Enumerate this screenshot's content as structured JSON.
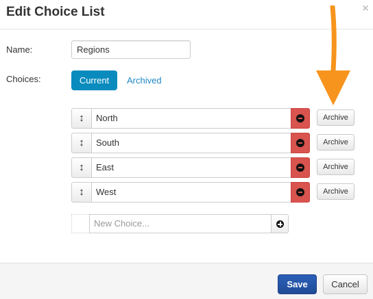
{
  "dialog": {
    "title": "Edit Choice List",
    "close_glyph": "×"
  },
  "form": {
    "name_label": "Name:",
    "name_value": "Regions",
    "choices_label": "Choices:"
  },
  "tabs": {
    "current": "Current",
    "archived": "Archived"
  },
  "choices": [
    {
      "value": "North",
      "archive_label": "Archive"
    },
    {
      "value": "South",
      "archive_label": "Archive"
    },
    {
      "value": "East",
      "archive_label": "Archive"
    },
    {
      "value": "West",
      "archive_label": "Archive"
    }
  ],
  "icons": {
    "drag": "↕",
    "remove": "minus-circle-icon",
    "add": "plus-circle-icon"
  },
  "new_choice": {
    "placeholder": "New Choice..."
  },
  "footer": {
    "save_label": "Save",
    "cancel_label": "Cancel"
  },
  "colors": {
    "primary_tab": "#0a8bbd",
    "remove": "#d9534f",
    "save": "#1f4c97",
    "annotation_arrow": "#f7941d"
  }
}
